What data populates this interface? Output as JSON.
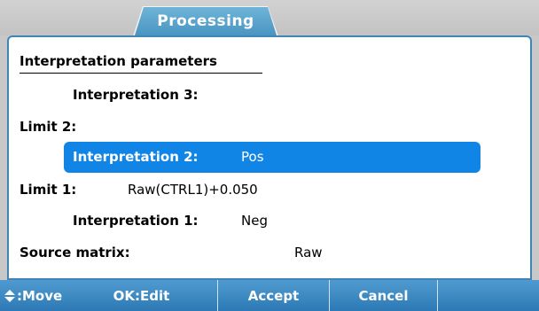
{
  "header": {
    "tab_label": "Processing"
  },
  "section": {
    "title": "Interpretation parameters"
  },
  "rows": {
    "interpretation3": {
      "label": "Interpretation 3:",
      "value": ""
    },
    "limit2": {
      "label": "Limit 2:",
      "value": ""
    },
    "interpretation2": {
      "label": "Interpretation 2:",
      "value": "Pos"
    },
    "limit1": {
      "label": "Limit 1:",
      "value": "Raw(CTRL1)+0.050"
    },
    "interpretation1": {
      "label": "Interpretation 1:",
      "value": "Neg"
    },
    "source_matrix": {
      "label": "Source matrix:",
      "value": "Raw"
    }
  },
  "softkeys": {
    "move": ":Move",
    "ok_edit": "OK:Edit",
    "accept": "Accept",
    "cancel": "Cancel"
  },
  "colors": {
    "accent": "#1185e6",
    "bar": "#3c88c2",
    "panel_border": "#3f86b6"
  },
  "icons": {
    "move": "up-down-arrows-icon"
  }
}
